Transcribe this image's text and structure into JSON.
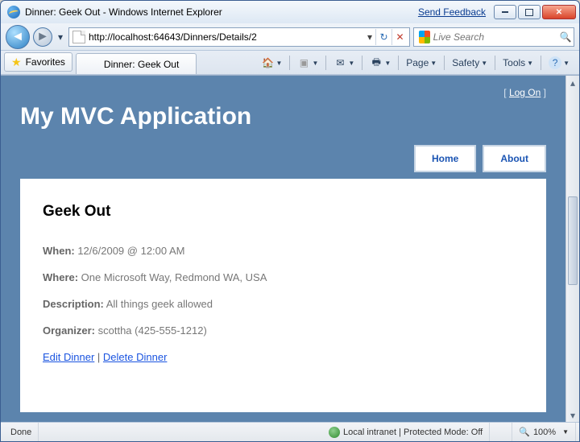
{
  "window": {
    "title": "Dinner: Geek Out - Windows Internet Explorer",
    "feedback": "Send Feedback"
  },
  "nav": {
    "url": "http://localhost:64643/Dinners/Details/2",
    "search_placeholder": "Live Search"
  },
  "favbar": {
    "favorites": "Favorites",
    "tab_title": "Dinner: Geek Out"
  },
  "toolbar": {
    "page": "Page",
    "safety": "Safety",
    "tools": "Tools"
  },
  "app": {
    "logon_left": "[ ",
    "logon_link": "Log On",
    "logon_right": " ]",
    "title": "My MVC Application",
    "tabs": {
      "home": "Home",
      "about": "About"
    }
  },
  "dinner": {
    "heading": "Geek Out",
    "when_label": "When:",
    "when_value": " 12/6/2009 @ 12:00 AM",
    "where_label": "Where:",
    "where_value": " One Microsoft Way, Redmond WA, USA",
    "desc_label": "Description:",
    "desc_value": " All things geek allowed",
    "org_label": "Organizer:",
    "org_value": " scottha (425-555-1212)",
    "edit": "Edit Dinner",
    "sep": " | ",
    "delete": "Delete Dinner"
  },
  "status": {
    "done": "Done",
    "zone": "Local intranet | Protected Mode: Off",
    "zoom": "100%"
  }
}
